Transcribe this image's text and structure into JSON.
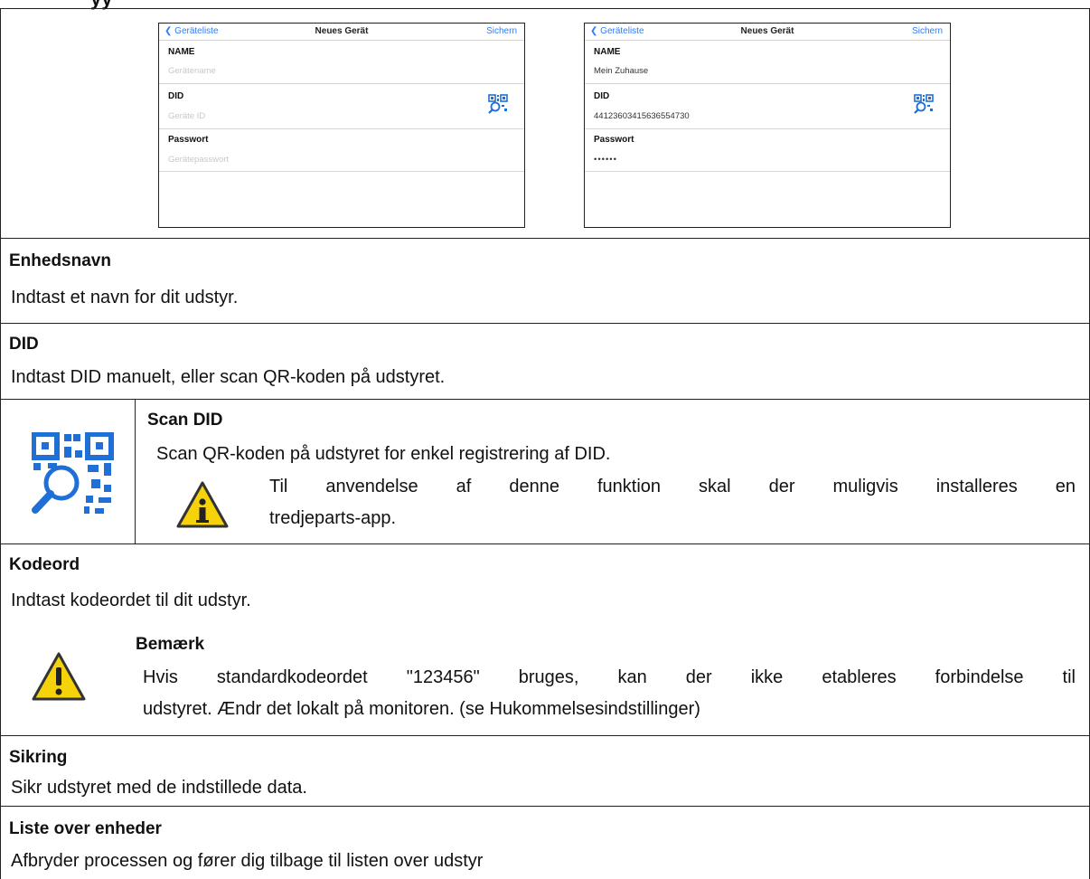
{
  "top_title_fragment": "yy",
  "screens": [
    {
      "back_label": "Geräteliste",
      "title": "Neues Gerät",
      "save_label": "Sichern",
      "name_label": "NAME",
      "name_value": "Gerätename",
      "did_label": "DID",
      "did_value": "Geräte ID",
      "password_label": "Passwort",
      "password_value": "Gerätepasswort",
      "placeholder": true
    },
    {
      "back_label": "Geräteliste",
      "title": "Neues Gerät",
      "save_label": "Sichern",
      "name_label": "NAME",
      "name_value": "Mein Zuhause",
      "did_label": "DID",
      "did_value": "44123603415636554730",
      "password_label": "Passwort",
      "password_value": "••••••",
      "placeholder": false
    }
  ],
  "sections": {
    "device_name": {
      "heading": "Enhedsnavn",
      "text": "Indtast et navn for dit udstyr."
    },
    "did": {
      "heading": "DID",
      "text": "Indtast DID manuelt, eller scan QR-koden på udstyret."
    },
    "scan_did": {
      "heading": "Scan DID",
      "text": "Scan QR-koden på udstyret for enkel registrering af DID.",
      "info_line1": "Til anvendelse af denne funktion skal der muligvis installeres en",
      "info_line2": "tredjeparts-app."
    },
    "password": {
      "heading": "Kodeord",
      "text": "Indtast kodeordet til dit udstyr.",
      "note_heading": "Bemærk",
      "note_line1": "Hvis standardkodeordet \"123456\" bruges, kan der ikke etableres forbindelse til",
      "note_line2": "udstyret. Ændr det lokalt på monitoren. (se Hukommelsesindstillinger)"
    },
    "save": {
      "heading": "Sikring",
      "text": "Sikr udstyret med de indstillede data."
    },
    "device_list": {
      "heading": "Liste over enheder",
      "text": "Afbryder processen og fører dig tilbage til listen over udstyr"
    }
  },
  "colors": {
    "ios_blue": "#2d7cf6",
    "qr_blue": "#1f6fd6",
    "warning_yellow": "#f5d20a",
    "border": "#222222"
  },
  "icons": [
    "qr-scan-icon",
    "info-icon",
    "warning-icon",
    "chevron-left-icon"
  ]
}
